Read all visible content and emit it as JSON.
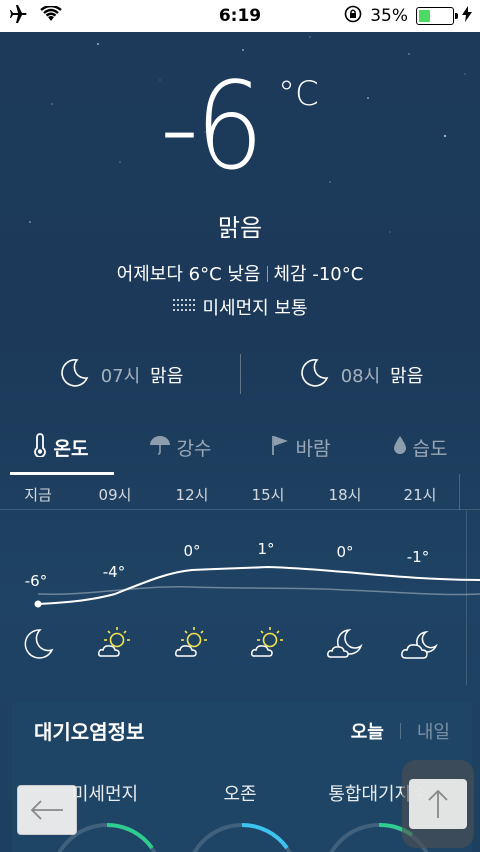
{
  "status_bar": {
    "time": "6:19",
    "battery_percent_label": "35%",
    "battery_level": 0.35,
    "icons": [
      "airplane-icon",
      "wifi-icon",
      "rotation-lock-icon",
      "battery-icon",
      "charging-icon"
    ]
  },
  "current": {
    "temperature": "-6",
    "unit": "°C",
    "condition": "맑음",
    "comparison": "어제보다 6°C 낮음",
    "feels_like": "체감 -10°C",
    "fine_dust": "미세먼지 보통"
  },
  "next_hours": [
    {
      "time": "07시",
      "condition": "맑음",
      "icon": "moon-icon"
    },
    {
      "time": "08시",
      "condition": "맑음",
      "icon": "moon-icon"
    }
  ],
  "tabs": [
    {
      "label": "온도",
      "icon": "thermometer-icon",
      "active": true
    },
    {
      "label": "강수",
      "icon": "umbrella-icon",
      "active": false
    },
    {
      "label": "바람",
      "icon": "flag-icon",
      "active": false
    },
    {
      "label": "습도",
      "icon": "droplet-icon",
      "active": false
    }
  ],
  "forecast": [
    {
      "time": "지금",
      "temp": "-6°",
      "icon": "moon-icon"
    },
    {
      "time": "09시",
      "temp": "-4°",
      "icon": "sun-cloud-icon"
    },
    {
      "time": "12시",
      "temp": "0°",
      "icon": "sun-cloud-icon"
    },
    {
      "time": "15시",
      "temp": "1°",
      "icon": "sun-cloud-icon"
    },
    {
      "time": "18시",
      "temp": "0°",
      "icon": "moon-cloud-icon"
    },
    {
      "time": "21시",
      "temp": "-1°",
      "icon": "moon-cloud-icon"
    }
  ],
  "air_quality": {
    "title": "대기오염정보",
    "today_label": "오늘",
    "tomorrow_label": "내일",
    "items": [
      "미세먼지",
      "오존",
      "통합대기지수"
    ]
  },
  "colors": {
    "background": "#1d3a5a",
    "card": "#1f4566",
    "sun": "#f5e44b",
    "gauge_green": "#2ecc8f",
    "gauge_blue": "#3cc3f0"
  }
}
